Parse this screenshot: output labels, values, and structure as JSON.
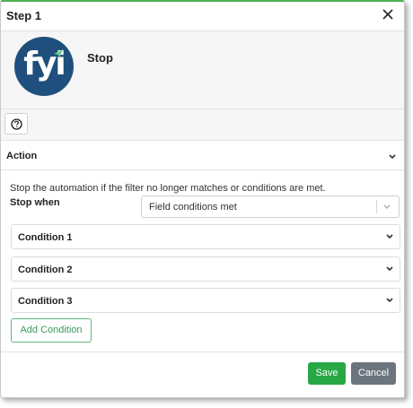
{
  "dialog": {
    "title": "Step 1",
    "close_icon": "close-icon"
  },
  "step": {
    "logo_text": "fyi",
    "logo_color": "#1f4f7c",
    "name": "Stop"
  },
  "help": {
    "icon": "help-circle-icon"
  },
  "action": {
    "header": "Action",
    "description": "Stop the automation if the filter no longer matches or conditions are met.",
    "stop_when_label": "Stop when",
    "stop_when_value": "Field conditions met",
    "conditions": [
      {
        "label": "Condition 1"
      },
      {
        "label": "Condition 2"
      },
      {
        "label": "Condition 3"
      }
    ],
    "add_condition_label": "Add Condition"
  },
  "footer": {
    "save_label": "Save",
    "cancel_label": "Cancel"
  },
  "colors": {
    "accent": "#28a745",
    "secondary": "#6c757d",
    "add_condition": "#3a9a5c"
  }
}
